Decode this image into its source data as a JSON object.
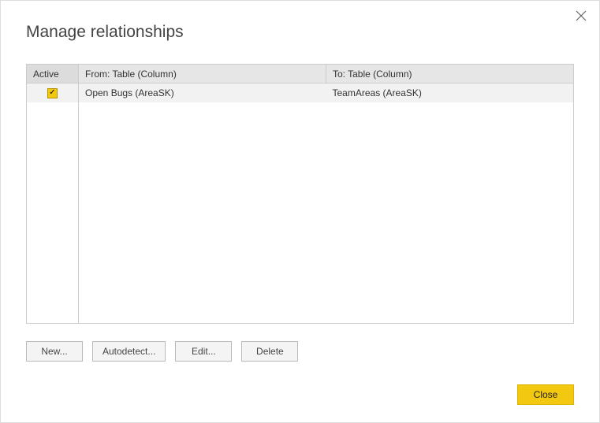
{
  "dialog": {
    "title": "Manage relationships"
  },
  "table": {
    "headers": {
      "active": "Active",
      "from": "From: Table (Column)",
      "to": "To: Table (Column)"
    },
    "rows": [
      {
        "active": true,
        "from": "Open Bugs (AreaSK)",
        "to": "TeamAreas (AreaSK)"
      }
    ]
  },
  "buttons": {
    "new": "New...",
    "autodetect": "Autodetect...",
    "edit": "Edit...",
    "delete": "Delete",
    "close": "Close"
  },
  "icons": {
    "check": "✓"
  }
}
